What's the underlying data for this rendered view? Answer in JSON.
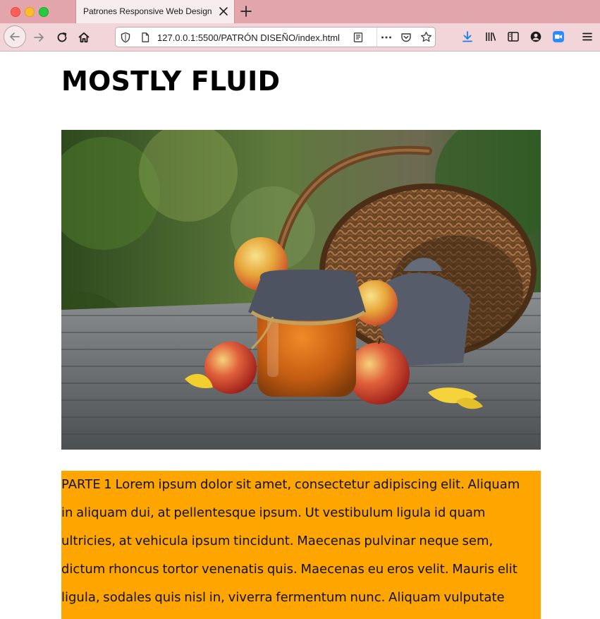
{
  "browser": {
    "tab_title": "Patrones Responsive Web Design",
    "url": "127.0.0.1:5500/PATRÓN DISEÑO/index.html"
  },
  "page": {
    "heading": "MOSTLY FLUID",
    "image_alt": "Jar of jam with apples and a wicker basket on a wooden table",
    "paragraph_lines": [
      "PARTE 1 Lorem ipsum dolor sit amet, consectetur adipiscing elit. Aliquam",
      "in aliquam dui, at pellentesque ipsum. Ut vestibulum ligula id quam",
      "ultricies, at vehicula ipsum tincidunt. Maecenas pulvinar neque sem,",
      "dictum rhoncus tortor venenatis quis. Maecenas eu eros velit. Mauris elit",
      "ligula, sodales quis nisl in, viverra fermentum nunc. Aliquam vulputate"
    ]
  },
  "colors": {
    "tab_strip": "#e1a5ab",
    "toolbar": "#f1d5d8",
    "orange_block": "#ffa500",
    "download_accent": "#1a7fe8",
    "zoom_accent": "#2d8cff"
  },
  "icons": [
    "close-window-dot",
    "minimize-window-dot",
    "maximize-window-dot",
    "close-tab-icon",
    "new-tab-icon",
    "back-arrow-icon",
    "forward-arrow-icon",
    "reload-icon",
    "home-icon",
    "shield-icon",
    "page-icon",
    "reader-view-icon",
    "more-icon",
    "pocket-icon",
    "star-icon",
    "download-icon",
    "library-icon",
    "sidebar-icon",
    "account-icon",
    "zoom-icon",
    "menu-icon"
  ]
}
